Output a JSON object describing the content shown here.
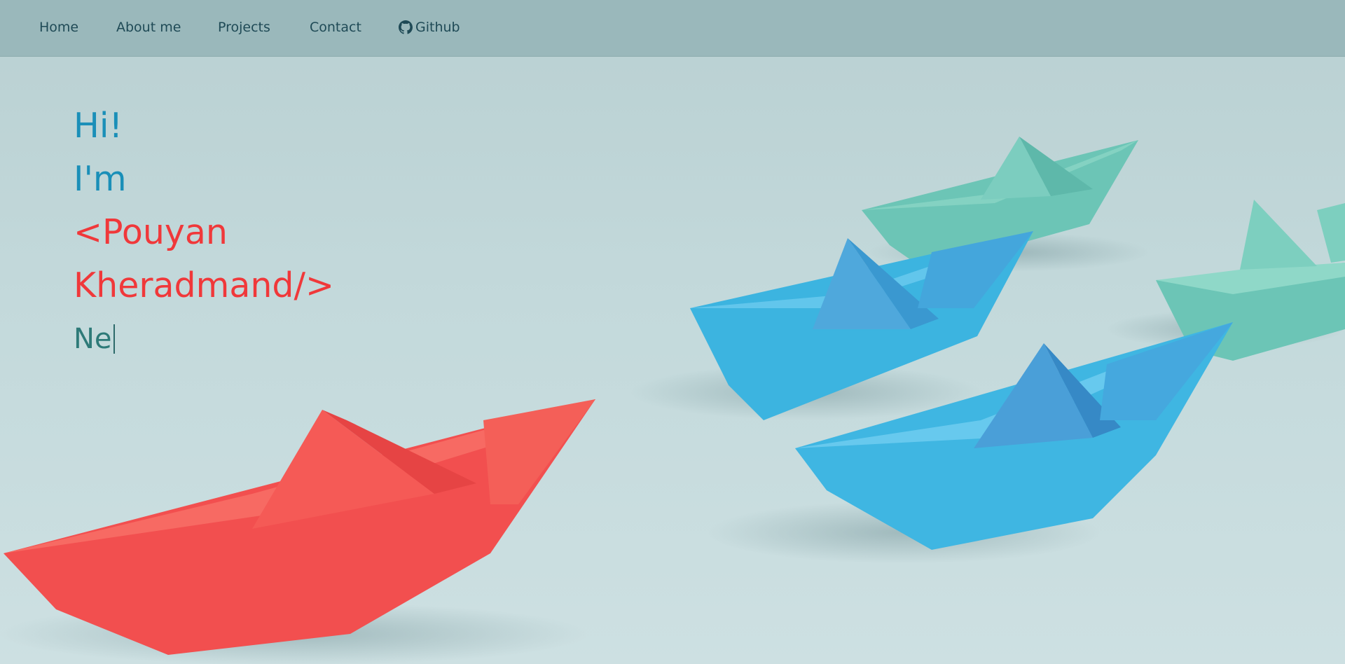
{
  "nav": {
    "items": [
      {
        "label": "Home"
      },
      {
        "label": "About me"
      },
      {
        "label": "Projects"
      },
      {
        "label": "Contact"
      },
      {
        "label": "Github",
        "icon": "github-icon"
      }
    ]
  },
  "hero": {
    "greeting": "Hi!",
    "intro": "I'm",
    "name_line1": "<Pouyan",
    "name_line2": "Kheradmand/>",
    "typed_text": "Ne"
  },
  "colors": {
    "nav_bg": "#9ab8bb",
    "nav_text": "#1f4a56",
    "greeting": "#1a8fb8",
    "name": "#f0383a",
    "typed": "#2d7a78",
    "background": "#c3d9db"
  }
}
